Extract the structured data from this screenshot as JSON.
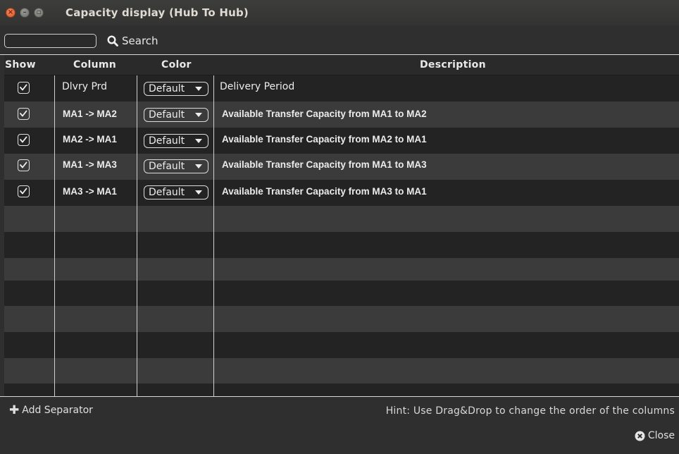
{
  "window": {
    "title": "Capacity display (Hub To Hub)"
  },
  "search": {
    "value": "",
    "label": "Search"
  },
  "table": {
    "headers": {
      "show": "Show",
      "column": "Column",
      "color": "Color",
      "description": "Description"
    },
    "rows": [
      {
        "checked": true,
        "column": "Dlvry Prd",
        "color": "Default",
        "description": "Delivery Period"
      },
      {
        "checked": true,
        "column": "MA1 -> MA2",
        "color": "Default",
        "description": "Available Transfer Capacity from MA1 to MA2"
      },
      {
        "checked": true,
        "column": "MA2 -> MA1",
        "color": "Default",
        "description": "Available Transfer Capacity from MA2 to MA1"
      },
      {
        "checked": true,
        "column": "MA1 -> MA3",
        "color": "Default",
        "description": "Available Transfer Capacity from MA1 to MA3"
      },
      {
        "checked": true,
        "column": "MA3 -> MA1",
        "color": "Default",
        "description": "Available Transfer Capacity from MA3 to MA1"
      }
    ]
  },
  "footer": {
    "add_separator": "Add Separator",
    "hint": "Hint: Use Drag&Drop to change the order of the columns",
    "close": "Close"
  }
}
